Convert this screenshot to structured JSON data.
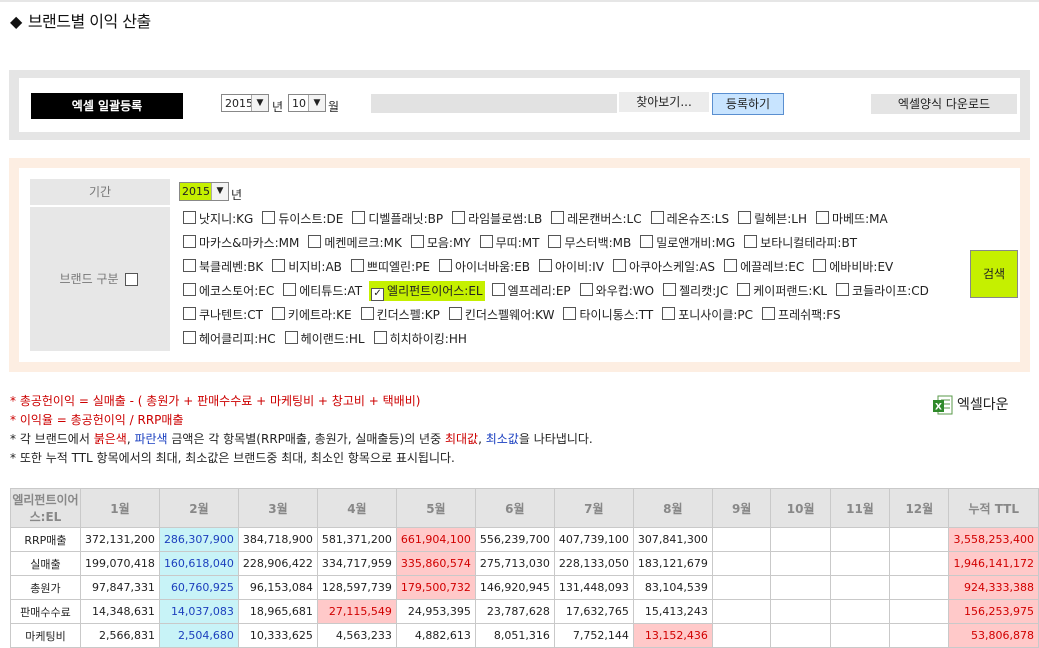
{
  "page_title": "브랜드별 이익 산출",
  "upload": {
    "label": "엑셀 일괄등록",
    "year": "2015",
    "year_unit": "년",
    "month": "10",
    "month_unit": "월",
    "browse_label": "찾아보기...",
    "register_label": "등록하기",
    "template_label": "엑셀양식 다운로드"
  },
  "search": {
    "period_label": "기간",
    "year": "2015",
    "year_unit": "년",
    "brand_label": "브랜드 구분",
    "search_label": "검색",
    "brand_rows": [
      [
        {
          "name": "낫지니:KG",
          "checked": false
        },
        {
          "name": "듀이스트:DE",
          "checked": false
        },
        {
          "name": "디벨플래닛:BP",
          "checked": false
        },
        {
          "name": "라임블로썸:LB",
          "checked": false
        },
        {
          "name": "레몬캔버스:LC",
          "checked": false
        },
        {
          "name": "레온슈즈:LS",
          "checked": false
        },
        {
          "name": "릴헤븐:LH",
          "checked": false
        },
        {
          "name": "마베뜨:MA",
          "checked": false
        }
      ],
      [
        {
          "name": "마카스&마카스:MM",
          "checked": false
        },
        {
          "name": "메켄메르크:MK",
          "checked": false
        },
        {
          "name": "모음:MY",
          "checked": false
        },
        {
          "name": "무띠:MT",
          "checked": false
        },
        {
          "name": "무스터백:MB",
          "checked": false
        },
        {
          "name": "밀로앤개비:MG",
          "checked": false
        },
        {
          "name": "보타니컬테라피:BT",
          "checked": false
        }
      ],
      [
        {
          "name": "북클레벤:BK",
          "checked": false
        },
        {
          "name": "비지비:AB",
          "checked": false
        },
        {
          "name": "쁘띠엘린:PE",
          "checked": false
        },
        {
          "name": "아이너바움:EB",
          "checked": false
        },
        {
          "name": "아이비:IV",
          "checked": false
        },
        {
          "name": "아쿠아스케일:AS",
          "checked": false
        },
        {
          "name": "에끌레브:EC",
          "checked": false
        },
        {
          "name": "에바비바:EV",
          "checked": false
        }
      ],
      [
        {
          "name": "에코스토어:EC",
          "checked": false
        },
        {
          "name": "에티튜드:AT",
          "checked": false
        },
        {
          "name": "엘리펀트이어스:EL",
          "checked": true
        },
        {
          "name": "엘프레리:EP",
          "checked": false
        },
        {
          "name": "와우컵:WO",
          "checked": false
        },
        {
          "name": "젤리캣:JC",
          "checked": false
        },
        {
          "name": "케이퍼랜드:KL",
          "checked": false
        },
        {
          "name": "코들라이프:CD",
          "checked": false
        }
      ],
      [
        {
          "name": "쿠나텐트:CT",
          "checked": false
        },
        {
          "name": "키에트라:KE",
          "checked": false
        },
        {
          "name": "킨더스펠:KP",
          "checked": false
        },
        {
          "name": "킨더스펠웨어:KW",
          "checked": false
        },
        {
          "name": "타이니통스:TT",
          "checked": false
        },
        {
          "name": "포니사이클:PC",
          "checked": false
        },
        {
          "name": "프레쉬팩:FS",
          "checked": false
        }
      ],
      [
        {
          "name": "헤어클리피:HC",
          "checked": false
        },
        {
          "name": "헤이랜드:HL",
          "checked": false
        },
        {
          "name": "히치하이킹:HH",
          "checked": false
        }
      ]
    ]
  },
  "notes": {
    "line1": "* 총공헌이익 = 실매출 - ( 총원가 + 판매수수료 + 마케팅비 + 창고비 + 택배비)",
    "line2": "* 이익율 = 총공헌이익 / RRP매출",
    "line3_a": "* 각 브랜드에서 ",
    "line3_red": "붉은색",
    "line3_b": ", ",
    "line3_blue": "파란색",
    "line3_c": " 금액은 각 항목별(RRP매출, 총원가, 실매출등)의 년중 ",
    "line3_max": "최대값",
    "line3_d": ", ",
    "line3_min": "최소값",
    "line3_e": "을 나타냅니다.",
    "line4": "* 또한 누적 TTL 항목에서의 최대, 최소값은 브랜드중 최대, 최소인 항목으로 표시됩니다."
  },
  "excel_download_label": "엑셀다운",
  "colors": {
    "highlight_green": "#c5f000",
    "max_bg": "#ffc9c9",
    "min_bg": "#c8f3f7",
    "max_text": "#d10000",
    "min_text": "#1c3fbd"
  },
  "table": {
    "corner": "엘리펀트이어스:EL",
    "headers": [
      "1월",
      "2월",
      "3월",
      "4월",
      "5월",
      "6월",
      "7월",
      "8월",
      "9월",
      "10월",
      "11월",
      "12월",
      "누적 TTL"
    ],
    "rows": [
      {
        "label": "RRP매출",
        "values": [
          "372,131,200",
          "286,307,900",
          "384,718,900",
          "581,371,200",
          "661,904,100",
          "556,239,700",
          "407,739,100",
          "307,841,300",
          "",
          "",
          "",
          "",
          "3,558,253,400"
        ],
        "min_col": 1,
        "max_col": 4
      },
      {
        "label": "실매출",
        "values": [
          "199,070,418",
          "160,618,040",
          "228,906,422",
          "334,717,959",
          "335,860,574",
          "275,713,030",
          "228,133,050",
          "183,121,679",
          "",
          "",
          "",
          "",
          "1,946,141,172"
        ],
        "min_col": 1,
        "max_col": 4
      },
      {
        "label": "총원가",
        "values": [
          "97,847,331",
          "60,760,925",
          "96,153,084",
          "128,597,739",
          "179,500,732",
          "146,920,945",
          "131,448,093",
          "83,104,539",
          "",
          "",
          "",
          "",
          "924,333,388"
        ],
        "min_col": 1,
        "max_col": 4
      },
      {
        "label": "판매수수료",
        "values": [
          "14,348,631",
          "14,037,083",
          "18,965,681",
          "27,115,549",
          "24,953,395",
          "23,787,628",
          "17,632,765",
          "15,413,243",
          "",
          "",
          "",
          "",
          "156,253,975"
        ],
        "min_col": 1,
        "max_col": 3
      },
      {
        "label": "마케팅비",
        "values": [
          "2,566,831",
          "2,504,680",
          "10,333,625",
          "4,563,233",
          "4,882,613",
          "8,051,316",
          "7,752,144",
          "13,152,436",
          "",
          "",
          "",
          "",
          "53,806,878"
        ],
        "min_col": 1,
        "max_col": 7
      }
    ]
  }
}
